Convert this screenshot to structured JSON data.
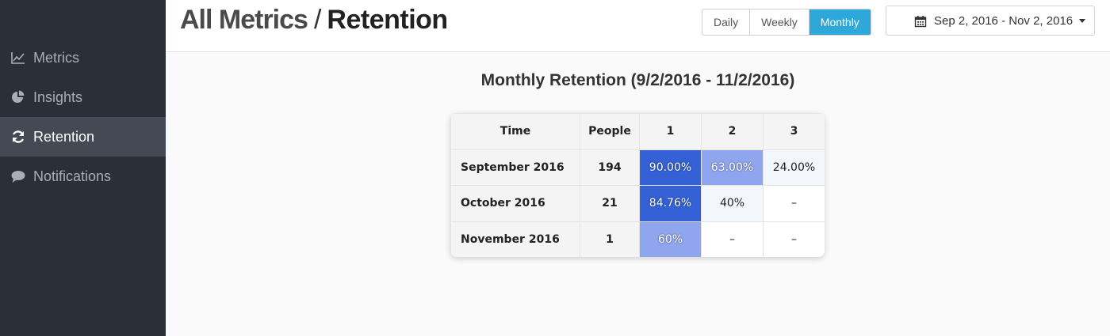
{
  "sidebar": {
    "items": [
      {
        "label": "Metrics",
        "icon": "line-chart-icon"
      },
      {
        "label": "Insights",
        "icon": "pie-chart-icon"
      },
      {
        "label": "Retention",
        "icon": "refresh-icon",
        "active": true
      },
      {
        "label": "Notifications",
        "icon": "comment-icon"
      }
    ]
  },
  "header": {
    "breadcrumb_root": "All Metrics",
    "breadcrumb_separator": "/",
    "breadcrumb_current": "Retention",
    "periods": [
      "Daily",
      "Weekly",
      "Monthly"
    ],
    "active_period": "Monthly",
    "date_range": "Sep 2, 2016 - Nov 2, 2016",
    "date_icon": "calendar-icon"
  },
  "report": {
    "title": "Monthly Retention (9/2/2016 - 11/2/2016)",
    "columns": [
      "Time",
      "People",
      "1",
      "2",
      "3"
    ],
    "rows": [
      {
        "time": "September 2016",
        "people": "194",
        "cells": [
          "90.00%",
          "63.00%",
          "24.00%"
        ]
      },
      {
        "time": "October 2016",
        "people": "21",
        "cells": [
          "84.76%",
          "40%",
          "–"
        ]
      },
      {
        "time": "November 2016",
        "people": "1",
        "cells": [
          "60%",
          "–",
          "–"
        ]
      }
    ]
  },
  "colors": {
    "sidebar_bg": "#2b3038",
    "sidebar_active_bg": "#444a53",
    "accent": "#2ea8d8",
    "cell_strong": "#3461d6",
    "cell_medium": "#8fa6ef",
    "cell_light": "#f3f6fc"
  },
  "chart_data": {
    "type": "table",
    "title": "Monthly Retention (9/2/2016 - 11/2/2016)",
    "columns": [
      "Time",
      "People",
      "1",
      "2",
      "3"
    ],
    "rows": [
      [
        "September 2016",
        194,
        90.0,
        63.0,
        24.0
      ],
      [
        "October 2016",
        21,
        84.76,
        40,
        null
      ],
      [
        "November 2016",
        1,
        60,
        null,
        null
      ]
    ]
  }
}
